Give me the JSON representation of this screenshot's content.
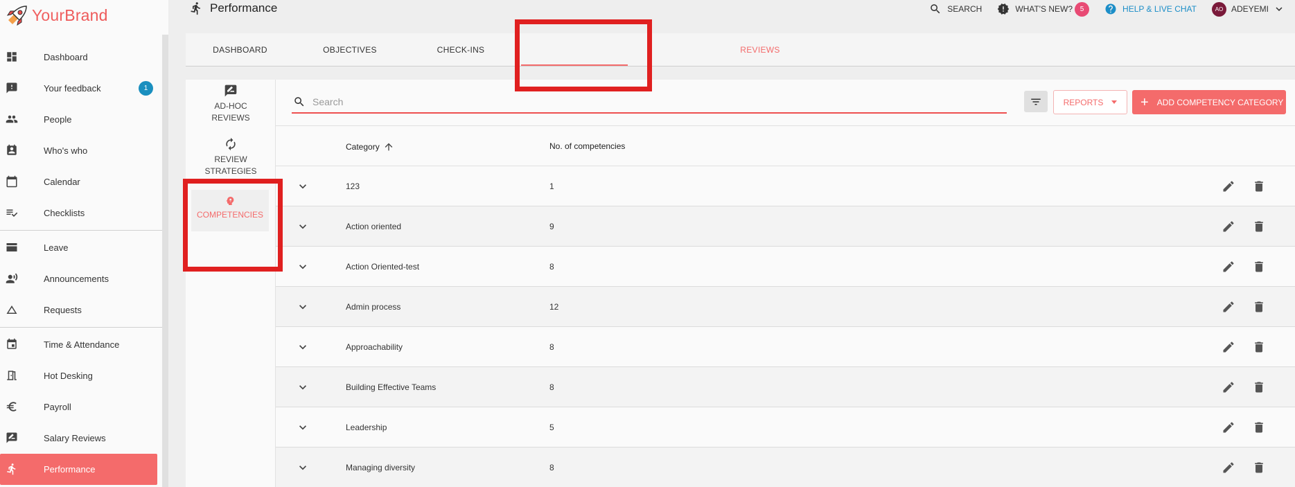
{
  "brand": {
    "name_part1": "Your",
    "name_part2": "Brand"
  },
  "sidebar": {
    "items": [
      {
        "label": "Dashboard",
        "icon": "dashboard-icon"
      },
      {
        "label": "Your feedback",
        "icon": "feedback-icon",
        "badge": "1"
      },
      {
        "label": "People",
        "icon": "people-icon"
      },
      {
        "label": "Who's who",
        "icon": "contact-card-icon"
      },
      {
        "label": "Calendar",
        "icon": "calendar-icon"
      },
      {
        "label": "Checklists",
        "icon": "checklist-icon"
      },
      {
        "label": "Leave",
        "icon": "leave-icon"
      },
      {
        "label": "Announcements",
        "icon": "announcement-icon"
      },
      {
        "label": "Requests",
        "icon": "triangle-icon"
      },
      {
        "label": "Time & Attendance",
        "icon": "event-icon"
      },
      {
        "label": "Hot Desking",
        "icon": "door-icon"
      },
      {
        "label": "Payroll",
        "icon": "euro-icon"
      },
      {
        "label": "Salary Reviews",
        "icon": "rate-review-icon"
      },
      {
        "label": "Performance",
        "icon": "running-icon"
      }
    ]
  },
  "header": {
    "title": "Performance",
    "search_label": "SEARCH",
    "whats_new_label": "WHAT'S NEW?",
    "whats_new_count": "5",
    "help_label": "HELP & LIVE CHAT",
    "user_initials": "AO",
    "user_name": "ADEYEMI"
  },
  "tabs": [
    {
      "label": "DASHBOARD"
    },
    {
      "label": "OBJECTIVES"
    },
    {
      "label": "CHECK-INS"
    },
    {
      "label": "REVIEWS"
    }
  ],
  "subnav": [
    {
      "line1": "AD-HOC",
      "line2": "REVIEWS"
    },
    {
      "line1": "REVIEW",
      "line2": "STRATEGIES"
    },
    {
      "line1": "COMPETENCIES",
      "line2": ""
    }
  ],
  "search": {
    "placeholder": "Search"
  },
  "toolbar": {
    "reports_label": "REPORTS",
    "add_label": "ADD COMPETENCY CATEGORY"
  },
  "table": {
    "headers": {
      "category": "Category",
      "count": "No. of competencies"
    },
    "rows": [
      {
        "category": "123",
        "count": "1"
      },
      {
        "category": "Action oriented",
        "count": "9"
      },
      {
        "category": "Action Oriented-test",
        "count": "8"
      },
      {
        "category": "Admin process",
        "count": "12"
      },
      {
        "category": "Approachability",
        "count": "8"
      },
      {
        "category": "Building Effective Teams",
        "count": "8"
      },
      {
        "category": "Leadership",
        "count": "5"
      },
      {
        "category": "Managing diversity",
        "count": "8"
      }
    ]
  },
  "colors": {
    "accent": "#f46b6b",
    "annotation": "#e02020",
    "help": "#1c8ec8",
    "badge": "#1a8fbf"
  }
}
